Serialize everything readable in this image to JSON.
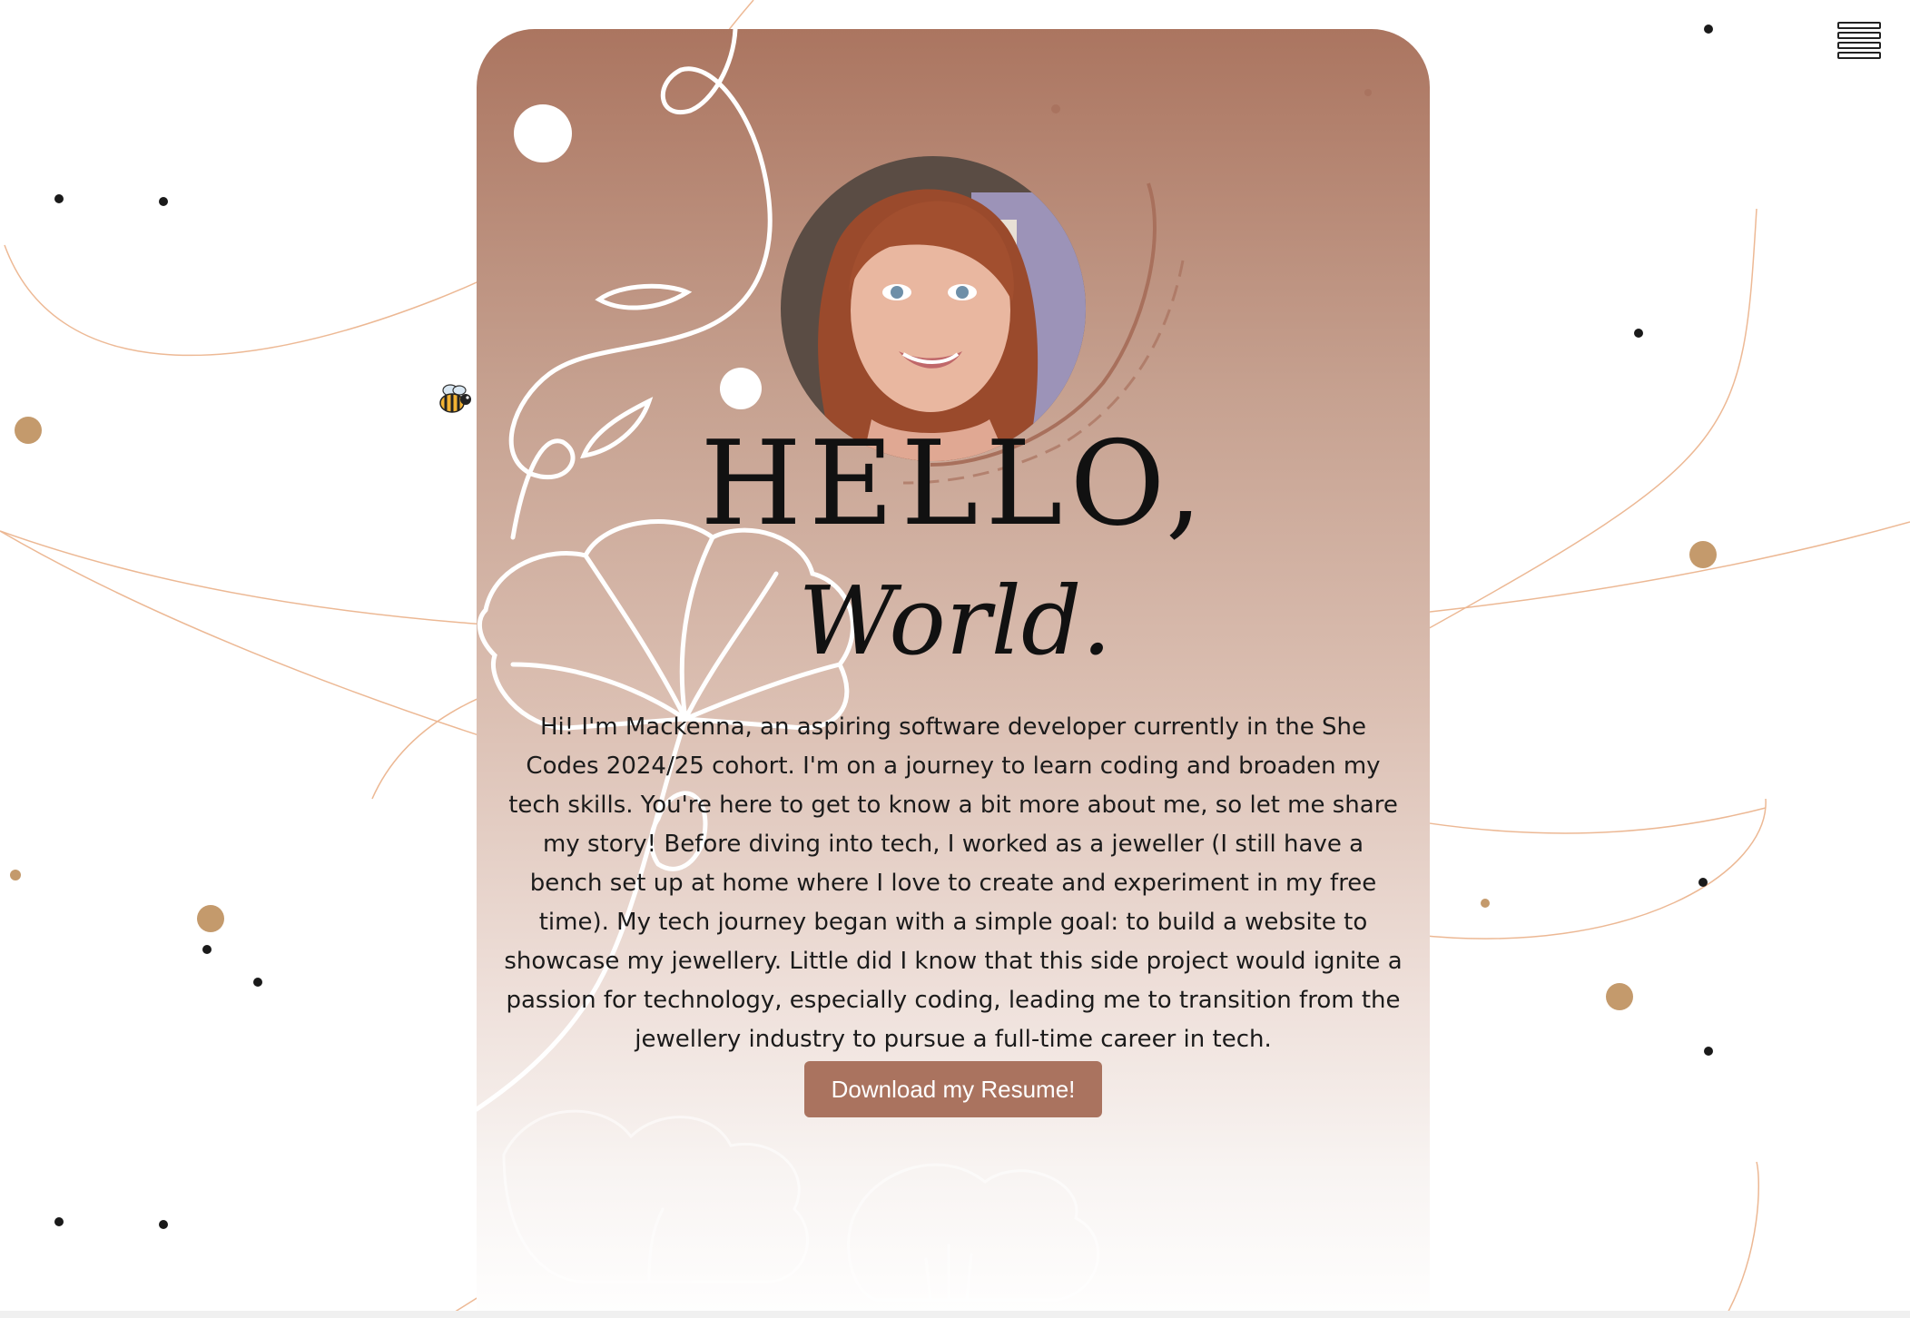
{
  "hero": {
    "greeting": "HELLO,",
    "subtitle": "World.",
    "bio": "Hi! I'm Mackenna, an aspiring software developer currently in the She Codes 2024/25 cohort. I'm on a journey to learn coding and broaden my tech skills. You're here to get to know a bit more about me, so let me share my story! Before diving into tech, I worked as a jeweller (I still have a bench set up at home where I love to create and experiment in my free time). My tech journey began with a simple goal: to build a website to showcase my jewellery. Little did I know that this side project would ignite a passion for technology, especially coding, leading me to transition from the jewellery industry to pursue a full-time career in tech.",
    "resume_button": "Download my Resume!"
  },
  "icons": {
    "menu": "hamburger-menu-icon",
    "bee": "bee-icon",
    "avatar": "profile-photo"
  },
  "colors": {
    "accent": "#aa735f",
    "card_top": "#ab7560",
    "gold_dot": "#c49a6c",
    "dark_dot": "#1a1a1a",
    "line": "#e8a77a"
  }
}
